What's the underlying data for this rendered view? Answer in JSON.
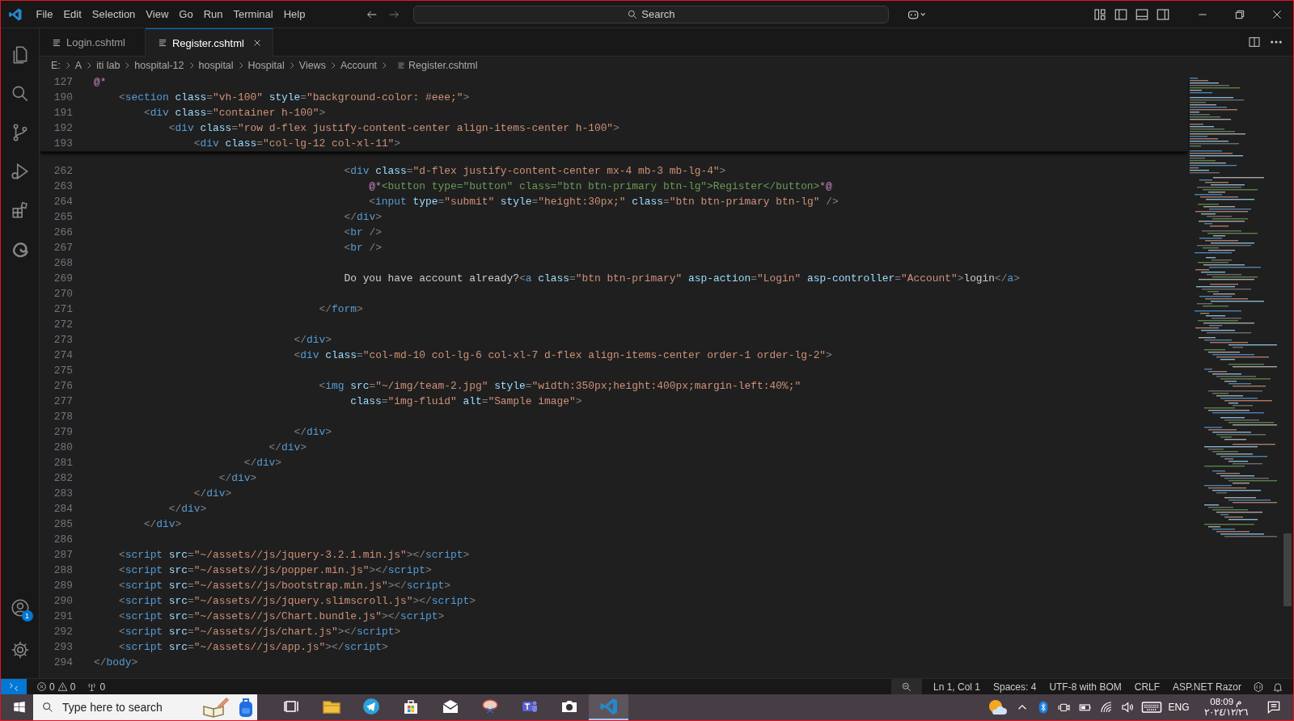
{
  "title_bar": {
    "menu": [
      "File",
      "Edit",
      "Selection",
      "View",
      "Go",
      "Run",
      "Terminal",
      "Help"
    ],
    "search": {
      "placeholder": "Search"
    }
  },
  "activity_bar": {
    "top_items": [
      {
        "kind": "explorer"
      },
      {
        "kind": "search"
      },
      {
        "kind": "source_control"
      },
      {
        "kind": "run"
      },
      {
        "kind": "extensions"
      },
      {
        "kind": "browser"
      }
    ],
    "bottom_items": [
      {
        "kind": "account",
        "badge": "1"
      },
      {
        "kind": "settings"
      }
    ]
  },
  "tabs": [
    {
      "label": "Login.cshtml",
      "selected": false
    },
    {
      "label": "Register.cshtml",
      "selected": true
    }
  ],
  "breadcrumbs": [
    "E:",
    "A",
    "iti lab",
    "hospital-12",
    "hospital",
    "Hospital",
    "Views",
    "Account",
    "Register.cshtml"
  ],
  "sticky_lines": [
    {
      "number": "127",
      "tokens": [
        {
          "kind": "razor",
          "text": "@*"
        }
      ]
    },
    {
      "number": "190",
      "tokens": [
        {
          "kind": "punct",
          "text": "    <"
        },
        {
          "kind": "tag",
          "text": "section"
        },
        {
          "kind": "attr",
          "text": " class"
        },
        {
          "kind": "punct",
          "text": "="
        },
        {
          "kind": "str",
          "text": "\"vh-100\""
        },
        {
          "kind": "attr",
          "text": " style"
        },
        {
          "kind": "punct",
          "text": "="
        },
        {
          "kind": "str",
          "text": "\"background-color: #eee;\""
        },
        {
          "kind": "punct",
          "text": ">"
        }
      ]
    },
    {
      "number": "191",
      "tokens": [
        {
          "kind": "punct",
          "text": "        <"
        },
        {
          "kind": "tag",
          "text": "div"
        },
        {
          "kind": "attr",
          "text": " class"
        },
        {
          "kind": "punct",
          "text": "="
        },
        {
          "kind": "str",
          "text": "\"container h-100\""
        },
        {
          "kind": "punct",
          "text": ">"
        }
      ]
    },
    {
      "number": "192",
      "tokens": [
        {
          "kind": "punct",
          "text": "            <"
        },
        {
          "kind": "tag",
          "text": "div"
        },
        {
          "kind": "attr",
          "text": " class"
        },
        {
          "kind": "punct",
          "text": "="
        },
        {
          "kind": "str",
          "text": "\"row d-flex justify-content-center align-items-center h-100\""
        },
        {
          "kind": "punct",
          "text": ">"
        }
      ]
    },
    {
      "number": "193",
      "tokens": [
        {
          "kind": "punct",
          "text": "                <"
        },
        {
          "kind": "tag",
          "text": "div"
        },
        {
          "kind": "attr",
          "text": " class"
        },
        {
          "kind": "punct",
          "text": "="
        },
        {
          "kind": "str",
          "text": "\"col-lg-12 col-xl-11\""
        },
        {
          "kind": "punct",
          "text": ">"
        }
      ]
    }
  ],
  "lines": [
    {
      "number": "262",
      "tokens": [
        {
          "kind": "punct",
          "text": "                                        <"
        },
        {
          "kind": "tag",
          "text": "div"
        },
        {
          "kind": "attr",
          "text": " class"
        },
        {
          "kind": "punct",
          "text": "="
        },
        {
          "kind": "str",
          "text": "\"d-flex justify-content-center mx-4 mb-3 mb-lg-4\""
        },
        {
          "kind": "punct",
          "text": ">"
        }
      ]
    },
    {
      "number": "263",
      "tokens": [
        {
          "kind": "razor",
          "text": "                                            @*"
        },
        {
          "kind": "comment",
          "text": "<button type=\"button\" class=\"btn btn-primary btn-lg\">Register</button>"
        },
        {
          "kind": "razor",
          "text": "*@"
        }
      ]
    },
    {
      "number": "264",
      "tokens": [
        {
          "kind": "punct",
          "text": "                                            <"
        },
        {
          "kind": "tag",
          "text": "input"
        },
        {
          "kind": "attr",
          "text": " type"
        },
        {
          "kind": "punct",
          "text": "="
        },
        {
          "kind": "str",
          "text": "\"submit\""
        },
        {
          "kind": "attr",
          "text": " style"
        },
        {
          "kind": "punct",
          "text": "="
        },
        {
          "kind": "str",
          "text": "\"height:30px;\""
        },
        {
          "kind": "attr",
          "text": " class"
        },
        {
          "kind": "punct",
          "text": "="
        },
        {
          "kind": "str",
          "text": "\"btn btn-primary btn-lg\""
        },
        {
          "kind": "punct",
          "text": " />"
        }
      ]
    },
    {
      "number": "265",
      "tokens": [
        {
          "kind": "punct",
          "text": "                                        </"
        },
        {
          "kind": "tag",
          "text": "div"
        },
        {
          "kind": "punct",
          "text": ">"
        }
      ]
    },
    {
      "number": "266",
      "tokens": [
        {
          "kind": "punct",
          "text": "                                        <"
        },
        {
          "kind": "tag",
          "text": "br"
        },
        {
          "kind": "punct",
          "text": " />"
        }
      ]
    },
    {
      "number": "267",
      "tokens": [
        {
          "kind": "punct",
          "text": "                                        <"
        },
        {
          "kind": "tag",
          "text": "br"
        },
        {
          "kind": "punct",
          "text": " />"
        }
      ]
    },
    {
      "number": "268"
    },
    {
      "number": "269",
      "tokens": [
        {
          "kind": "text",
          "text": "                                        Do you have account already?"
        },
        {
          "kind": "punct",
          "text": "<"
        },
        {
          "kind": "tag",
          "text": "a"
        },
        {
          "kind": "attr",
          "text": " class"
        },
        {
          "kind": "punct",
          "text": "="
        },
        {
          "kind": "str",
          "text": "\"btn btn-primary\""
        },
        {
          "kind": "attr",
          "text": " asp-action"
        },
        {
          "kind": "punct",
          "text": "="
        },
        {
          "kind": "str",
          "text": "\"Login\""
        },
        {
          "kind": "attr",
          "text": " asp-controller"
        },
        {
          "kind": "punct",
          "text": "="
        },
        {
          "kind": "str",
          "text": "\"Account\""
        },
        {
          "kind": "punct",
          "text": ">"
        },
        {
          "kind": "text",
          "text": "login"
        },
        {
          "kind": "punct",
          "text": "</"
        },
        {
          "kind": "tag",
          "text": "a"
        },
        {
          "kind": "punct",
          "text": ">"
        }
      ]
    },
    {
      "number": "270"
    },
    {
      "number": "271",
      "tokens": [
        {
          "kind": "punct",
          "text": "                                    </"
        },
        {
          "kind": "tag",
          "text": "form"
        },
        {
          "kind": "punct",
          "text": ">"
        }
      ]
    },
    {
      "number": "272"
    },
    {
      "number": "273",
      "tokens": [
        {
          "kind": "punct",
          "text": "                                </"
        },
        {
          "kind": "tag",
          "text": "div"
        },
        {
          "kind": "punct",
          "text": ">"
        }
      ]
    },
    {
      "number": "274",
      "tokens": [
        {
          "kind": "punct",
          "text": "                                <"
        },
        {
          "kind": "tag",
          "text": "div"
        },
        {
          "kind": "attr",
          "text": " class"
        },
        {
          "kind": "punct",
          "text": "="
        },
        {
          "kind": "str",
          "text": "\"col-md-10 col-lg-6 col-xl-7 d-flex align-items-center order-1 order-lg-2\""
        },
        {
          "kind": "punct",
          "text": ">"
        }
      ]
    },
    {
      "number": "275"
    },
    {
      "number": "276",
      "tokens": [
        {
          "kind": "punct",
          "text": "                                    <"
        },
        {
          "kind": "tag",
          "text": "img"
        },
        {
          "kind": "attr",
          "text": " src"
        },
        {
          "kind": "punct",
          "text": "="
        },
        {
          "kind": "str",
          "text": "\"~/img/team-2.jpg\""
        },
        {
          "kind": "attr",
          "text": " style"
        },
        {
          "kind": "punct",
          "text": "="
        },
        {
          "kind": "str",
          "text": "\"width:350px;height:400px;margin-left:40%;\""
        }
      ]
    },
    {
      "number": "277",
      "tokens": [
        {
          "kind": "attr",
          "text": "                                         class"
        },
        {
          "kind": "punct",
          "text": "="
        },
        {
          "kind": "str",
          "text": "\"img-fluid\""
        },
        {
          "kind": "attr",
          "text": " alt"
        },
        {
          "kind": "punct",
          "text": "="
        },
        {
          "kind": "str",
          "text": "\"Sample image\""
        },
        {
          "kind": "punct",
          "text": ">"
        }
      ]
    },
    {
      "number": "278"
    },
    {
      "number": "279",
      "tokens": [
        {
          "kind": "punct",
          "text": "                                </"
        },
        {
          "kind": "tag",
          "text": "div"
        },
        {
          "kind": "punct",
          "text": ">"
        }
      ]
    },
    {
      "number": "280",
      "tokens": [
        {
          "kind": "punct",
          "text": "                            </"
        },
        {
          "kind": "tag",
          "text": "div"
        },
        {
          "kind": "punct",
          "text": ">"
        }
      ]
    },
    {
      "number": "281",
      "tokens": [
        {
          "kind": "punct",
          "text": "                        </"
        },
        {
          "kind": "tag",
          "text": "div"
        },
        {
          "kind": "punct",
          "text": ">"
        }
      ]
    },
    {
      "number": "282",
      "tokens": [
        {
          "kind": "punct",
          "text": "                    </"
        },
        {
          "kind": "tag",
          "text": "div"
        },
        {
          "kind": "punct",
          "text": ">"
        }
      ]
    },
    {
      "number": "283",
      "tokens": [
        {
          "kind": "punct",
          "text": "                </"
        },
        {
          "kind": "tag",
          "text": "div"
        },
        {
          "kind": "punct",
          "text": ">"
        }
      ]
    },
    {
      "number": "284",
      "tokens": [
        {
          "kind": "punct",
          "text": "            </"
        },
        {
          "kind": "tag",
          "text": "div"
        },
        {
          "kind": "punct",
          "text": ">"
        }
      ]
    },
    {
      "number": "285",
      "tokens": [
        {
          "kind": "punct",
          "text": "        </"
        },
        {
          "kind": "tag",
          "text": "div"
        },
        {
          "kind": "punct",
          "text": ">"
        }
      ]
    },
    {
      "number": "286"
    },
    {
      "number": "287",
      "tokens": [
        {
          "kind": "punct",
          "text": "    <"
        },
        {
          "kind": "tag",
          "text": "script"
        },
        {
          "kind": "attr",
          "text": " src"
        },
        {
          "kind": "punct",
          "text": "="
        },
        {
          "kind": "str",
          "text": "\"~/assets//js/jquery-3.2.1.min.js\""
        },
        {
          "kind": "punct",
          "text": "></"
        },
        {
          "kind": "tag",
          "text": "script"
        },
        {
          "kind": "punct",
          "text": ">"
        }
      ]
    },
    {
      "number": "288",
      "tokens": [
        {
          "kind": "punct",
          "text": "    <"
        },
        {
          "kind": "tag",
          "text": "script"
        },
        {
          "kind": "attr",
          "text": " src"
        },
        {
          "kind": "punct",
          "text": "="
        },
        {
          "kind": "str",
          "text": "\"~/assets//js/popper.min.js\""
        },
        {
          "kind": "punct",
          "text": "></"
        },
        {
          "kind": "tag",
          "text": "script"
        },
        {
          "kind": "punct",
          "text": ">"
        }
      ]
    },
    {
      "number": "289",
      "tokens": [
        {
          "kind": "punct",
          "text": "    <"
        },
        {
          "kind": "tag",
          "text": "script"
        },
        {
          "kind": "attr",
          "text": " src"
        },
        {
          "kind": "punct",
          "text": "="
        },
        {
          "kind": "str",
          "text": "\"~/assets//js/bootstrap.min.js\""
        },
        {
          "kind": "punct",
          "text": "></"
        },
        {
          "kind": "tag",
          "text": "script"
        },
        {
          "kind": "punct",
          "text": ">"
        }
      ]
    },
    {
      "number": "290",
      "tokens": [
        {
          "kind": "punct",
          "text": "    <"
        },
        {
          "kind": "tag",
          "text": "script"
        },
        {
          "kind": "attr",
          "text": " src"
        },
        {
          "kind": "punct",
          "text": "="
        },
        {
          "kind": "str",
          "text": "\"~/assets//js/jquery.slimscroll.js\""
        },
        {
          "kind": "punct",
          "text": "></"
        },
        {
          "kind": "tag",
          "text": "script"
        },
        {
          "kind": "punct",
          "text": ">"
        }
      ]
    },
    {
      "number": "291",
      "tokens": [
        {
          "kind": "punct",
          "text": "    <"
        },
        {
          "kind": "tag",
          "text": "script"
        },
        {
          "kind": "attr",
          "text": " src"
        },
        {
          "kind": "punct",
          "text": "="
        },
        {
          "kind": "str",
          "text": "\"~/assets//js/Chart.bundle.js\""
        },
        {
          "kind": "punct",
          "text": "></"
        },
        {
          "kind": "tag",
          "text": "script"
        },
        {
          "kind": "punct",
          "text": ">"
        }
      ]
    },
    {
      "number": "292",
      "tokens": [
        {
          "kind": "punct",
          "text": "    <"
        },
        {
          "kind": "tag",
          "text": "script"
        },
        {
          "kind": "attr",
          "text": " src"
        },
        {
          "kind": "punct",
          "text": "="
        },
        {
          "kind": "str",
          "text": "\"~/assets//js/chart.js\""
        },
        {
          "kind": "punct",
          "text": "></"
        },
        {
          "kind": "tag",
          "text": "script"
        },
        {
          "kind": "punct",
          "text": ">"
        }
      ]
    },
    {
      "number": "293",
      "tokens": [
        {
          "kind": "punct",
          "text": "    <"
        },
        {
          "kind": "tag",
          "text": "script"
        },
        {
          "kind": "attr",
          "text": " src"
        },
        {
          "kind": "punct",
          "text": "="
        },
        {
          "kind": "str",
          "text": "\"~/assets//js/app.js\""
        },
        {
          "kind": "punct",
          "text": "></"
        },
        {
          "kind": "tag",
          "text": "script"
        },
        {
          "kind": "punct",
          "text": ">"
        }
      ]
    },
    {
      "number": "294",
      "tokens": [
        {
          "kind": "punct",
          "text": "</"
        },
        {
          "kind": "tag",
          "text": "body"
        },
        {
          "kind": "punct",
          "text": ">"
        }
      ]
    }
  ],
  "status_bar": {
    "errors": "0",
    "warnings": "0",
    "ports": "0",
    "items": [
      "Ln 1, Col 1",
      "Spaces: 4",
      "UTF-8 with BOM",
      "CRLF",
      "ASP.NET Razor"
    ]
  },
  "taskbar": {
    "search": {
      "placeholder": "Type here to search"
    },
    "apps": [
      {
        "kind": "task_view",
        "selected": false
      },
      {
        "kind": "folder",
        "selected": false
      },
      {
        "kind": "telegram",
        "selected": false
      },
      {
        "kind": "store",
        "selected": false
      },
      {
        "kind": "mail",
        "selected": false
      },
      {
        "kind": "snip",
        "selected": false
      },
      {
        "kind": "teams",
        "selected": false
      },
      {
        "kind": "camera",
        "selected": false
      },
      {
        "kind": "vscode",
        "selected": true
      }
    ],
    "language": "ENG",
    "time": "08:09 م",
    "date": "٢٠٢٤/١٢/٢٦"
  }
}
